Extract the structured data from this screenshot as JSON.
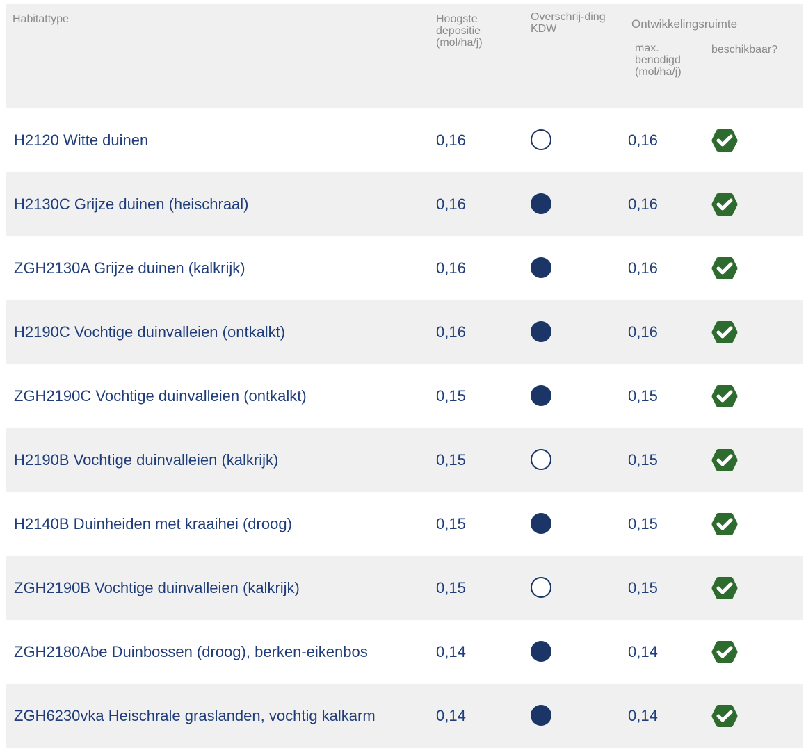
{
  "header": {
    "habitattype": "Habitattype",
    "hoogste_depositie": "Hoogste depositie (mol/ha/j)",
    "overschrijding": "Overschrij-ding KDW",
    "ontwikkelingsruimte": "Ontwikkelingsruimte",
    "max_benodigd": "max. benodigd (mol/ha/j)",
    "beschikbaar": "beschikbaar?"
  },
  "colors": {
    "text": "#1f3d7a",
    "header_text": "#8a8a8a",
    "row_shade": "#f0f0f0",
    "dot": "#1c3567",
    "check": "#2e6b2e"
  },
  "rows": [
    {
      "name": "H2120 Witte duinen",
      "depositie": "0,16",
      "kdw_exceeded": false,
      "max": "0,16",
      "available_icon": "check-hexagon-icon"
    },
    {
      "name": "H2130C Grijze duinen (heischraal)",
      "depositie": "0,16",
      "kdw_exceeded": true,
      "max": "0,16",
      "available_icon": "check-hexagon-icon"
    },
    {
      "name": "ZGH2130A Grijze duinen (kalkrijk)",
      "depositie": "0,16",
      "kdw_exceeded": true,
      "max": "0,16",
      "available_icon": "check-hexagon-icon"
    },
    {
      "name": "H2190C Vochtige duinvalleien (ontkalkt)",
      "depositie": "0,16",
      "kdw_exceeded": true,
      "max": "0,16",
      "available_icon": "check-hexagon-icon"
    },
    {
      "name": "ZGH2190C Vochtige duinvalleien (ontkalkt)",
      "depositie": "0,15",
      "kdw_exceeded": true,
      "max": "0,15",
      "available_icon": "check-hexagon-icon"
    },
    {
      "name": "H2190B Vochtige duinvalleien (kalkrijk)",
      "depositie": "0,15",
      "kdw_exceeded": false,
      "max": "0,15",
      "available_icon": "check-hexagon-icon"
    },
    {
      "name": "H2140B Duinheiden met kraaihei (droog)",
      "depositie": "0,15",
      "kdw_exceeded": true,
      "max": "0,15",
      "available_icon": "check-hexagon-icon"
    },
    {
      "name": "ZGH2190B Vochtige duinvalleien (kalkrijk)",
      "depositie": "0,15",
      "kdw_exceeded": false,
      "max": "0,15",
      "available_icon": "check-hexagon-icon"
    },
    {
      "name": "ZGH2180Abe Duinbossen (droog), berken-eikenbos",
      "depositie": "0,14",
      "kdw_exceeded": true,
      "max": "0,14",
      "available_icon": "check-hexagon-icon"
    },
    {
      "name": "ZGH6230vka Heischrale graslanden, vochtig kalkarm",
      "depositie": "0,14",
      "kdw_exceeded": true,
      "max": "0,14",
      "available_icon": "check-hexagon-icon"
    }
  ]
}
